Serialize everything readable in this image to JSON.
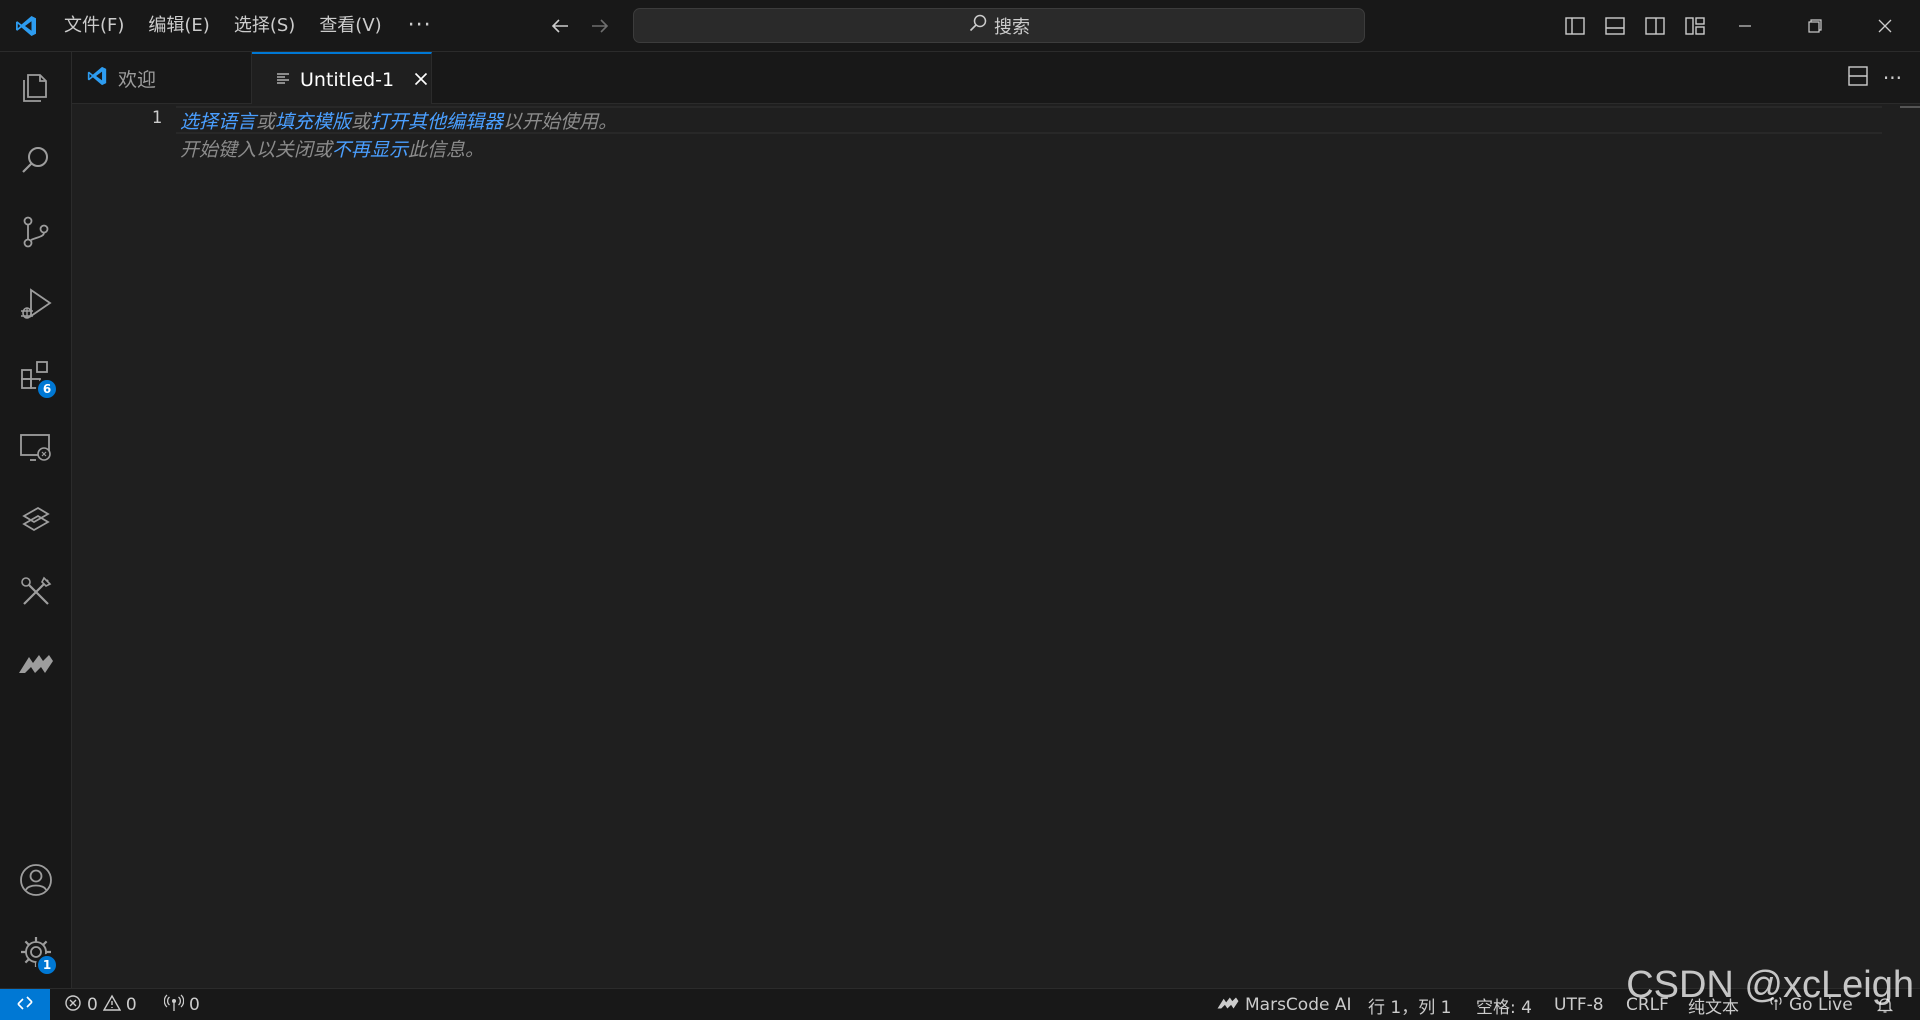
{
  "menu": {
    "items": [
      "文件(F)",
      "编辑(E)",
      "选择(S)",
      "查看(V)"
    ],
    "more": "···"
  },
  "search": {
    "label": "搜索"
  },
  "activity": {
    "extensions_badge": "6",
    "settings_badge": "1"
  },
  "tabs": [
    {
      "label": "欢迎"
    },
    {
      "label": "Untitled-1"
    }
  ],
  "tab_actions": {
    "more": "···"
  },
  "editor": {
    "line_number": "1",
    "hint_line1": {
      "link1": "选择语言",
      "t1": "或",
      "link2": "填充模版",
      "t2": "或",
      "link3": "打开其他编辑器",
      "t3": "以开始使用。"
    },
    "hint_line2": {
      "t1": "开始键入以关闭或",
      "link1": "不再显示",
      "t2": "此信息。"
    }
  },
  "status": {
    "errors": "0",
    "warnings": "0",
    "ports": "0",
    "marscode": "MarsCode AI",
    "position": "行 1，列 1",
    "spaces": "空格: 4",
    "encoding": "UTF-8",
    "eol": "CRLF",
    "language": "纯文本",
    "golive": "Go Live"
  },
  "watermark": "CSDN @xcLeigh",
  "colors": {
    "accent": "#0078d4",
    "link": "#4a9fff",
    "background": "#1f1f1f",
    "chrome": "#181818"
  }
}
